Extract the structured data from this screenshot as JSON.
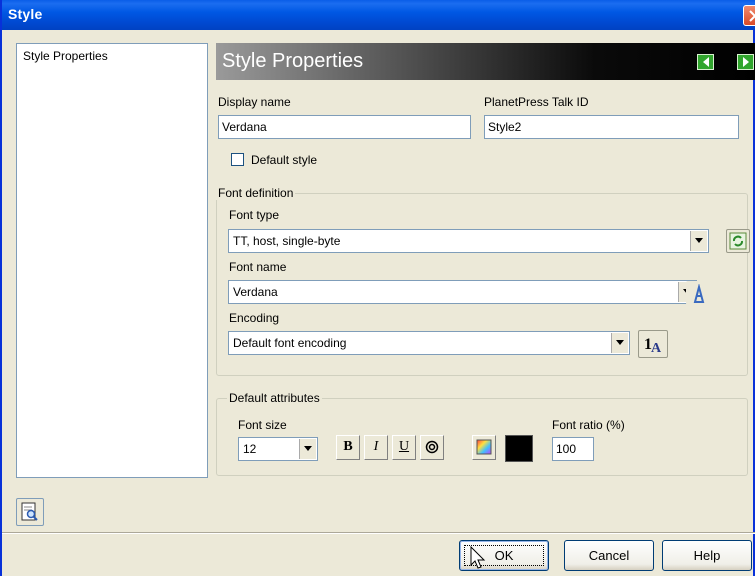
{
  "window": {
    "title": "Style"
  },
  "sidebar": {
    "items": [
      {
        "label": "Style Properties"
      }
    ]
  },
  "header": {
    "title": "Style Properties"
  },
  "form": {
    "display_name_label": "Display name",
    "display_name_value": "Verdana",
    "talk_id_label": "PlanetPress Talk ID",
    "talk_id_value": "Style2",
    "default_style_label": "Default style",
    "default_style_checked": false
  },
  "font_definition": {
    "legend": "Font definition",
    "font_type_label": "Font type",
    "font_type_value": "TT, host, single-byte",
    "font_name_label": "Font name",
    "font_name_value": "Verdana",
    "encoding_label": "Encoding",
    "encoding_value": "Default font encoding"
  },
  "default_attributes": {
    "legend": "Default attributes",
    "font_size_label": "Font size",
    "font_size_value": "12",
    "bold_label": "B",
    "italic_label": "I",
    "underline_label": "U",
    "font_ratio_label": "Font ratio (%)",
    "font_ratio_value": "100",
    "text_color": "#000000"
  },
  "footer": {
    "ok_label": "OK",
    "cancel_label": "Cancel",
    "help_label": "Help"
  },
  "colors": {
    "titlebar": "#0058e4",
    "dialog_bg": "#ece9d8",
    "nav_arrow": "#31a52e"
  }
}
